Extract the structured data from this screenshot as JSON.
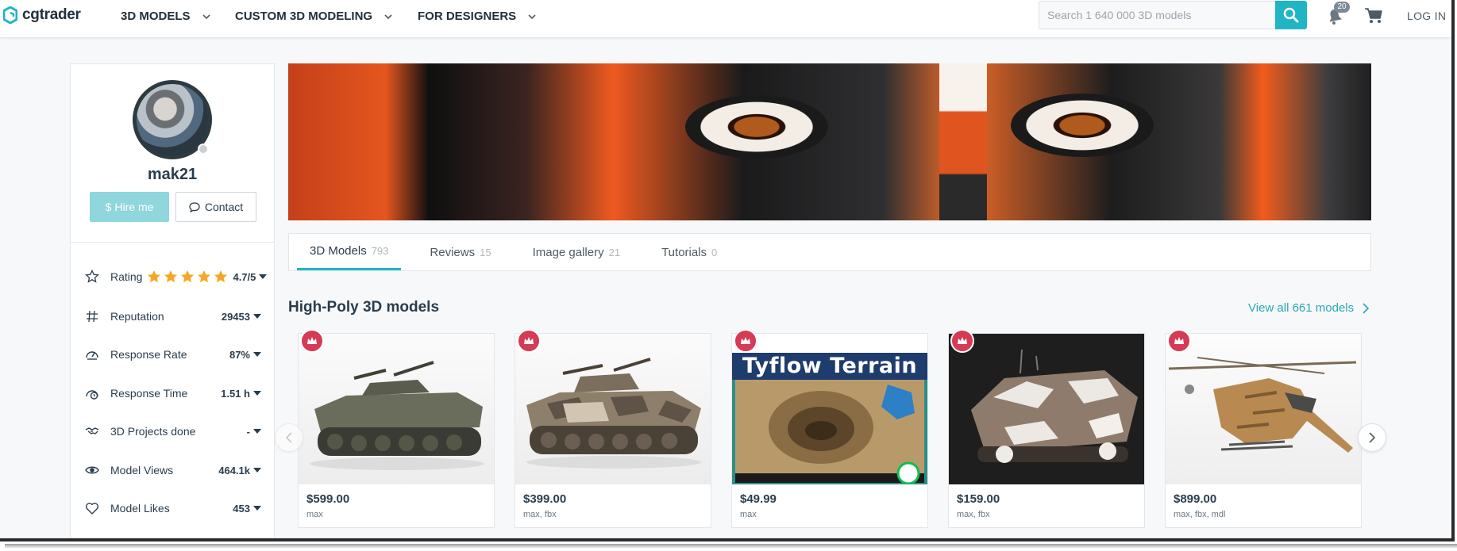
{
  "header": {
    "logo_text": "cgtrader",
    "nav": [
      {
        "label": "3D MODELS"
      },
      {
        "label": "CUSTOM 3D MODELING"
      },
      {
        "label": "FOR DESIGNERS"
      }
    ],
    "search_placeholder": "Search 1 640 000 3D models",
    "notification_count": "20",
    "login_label": "LOG IN"
  },
  "profile": {
    "username": "mak21",
    "hire_label": "Hire me",
    "contact_label": "Contact",
    "stats": [
      {
        "label": "Rating",
        "value": "4.7/5",
        "icon": "star-outline-icon",
        "stars": 5
      },
      {
        "label": "Reputation",
        "value": "29453",
        "icon": "hash-icon"
      },
      {
        "label": "Response Rate",
        "value": "87%",
        "icon": "gauge-icon"
      },
      {
        "label": "Response Time",
        "value": "1.51 h",
        "icon": "timer-icon"
      },
      {
        "label": "3D Projects done",
        "value": "-",
        "icon": "handshake-icon"
      },
      {
        "label": "Model Views",
        "value": "464.1k",
        "icon": "eye-icon"
      },
      {
        "label": "Model Likes",
        "value": "453",
        "icon": "heart-icon"
      }
    ]
  },
  "tabs": [
    {
      "label": "3D Models",
      "count": "793",
      "active": true
    },
    {
      "label": "Reviews",
      "count": "15"
    },
    {
      "label": "Image gallery",
      "count": "21"
    },
    {
      "label": "Tutorials",
      "count": "0"
    }
  ],
  "section": {
    "title": "High-Poly 3D models",
    "view_all": "View all 661 models"
  },
  "cards": [
    {
      "price": "$599.00",
      "formats": "max",
      "subject": "tank-olive"
    },
    {
      "price": "$399.00",
      "formats": "max, fbx",
      "subject": "tank-camo"
    },
    {
      "price": "$49.99",
      "formats": "max",
      "subject": "tyflow-terrain",
      "overlay_title": "Tyflow Terrain"
    },
    {
      "price": "$159.00",
      "formats": "max, fbx",
      "subject": "tank-snow"
    },
    {
      "price": "$899.00",
      "formats": "max, fbx, mdl",
      "subject": "helicopter-camo"
    }
  ],
  "colors": {
    "accent": "#1fb5c4",
    "hire_button": "#8fd6dd",
    "star": "#f5a623",
    "badge": "#d63a55",
    "link": "#27a9b7"
  }
}
